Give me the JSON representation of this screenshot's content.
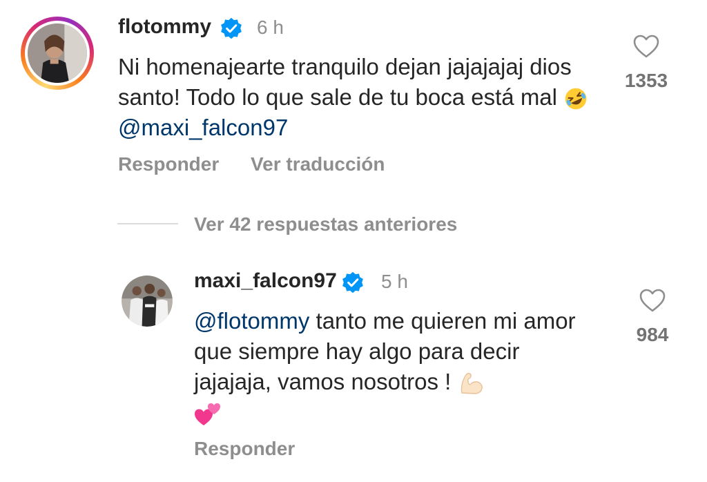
{
  "comment": {
    "username": "flotommy",
    "time": "6 h",
    "text_before": "Ni homenajearte tranquilo dejan jajajajaj dios santo! Todo lo que sale de tu boca está mal",
    "emoji": "rolling-on-floor-laughing",
    "mention": "@maxi_falcon97",
    "likes": "1353",
    "reply_label": "Responder",
    "translate_label": "Ver traducción"
  },
  "replies_toggle": {
    "label": "Ver 42 respuestas anteriores"
  },
  "reply": {
    "username": "maxi_falcon97",
    "time": "5 h",
    "mention": "@flotommy",
    "text": "tanto me quieren mi amor que siempre hay algo para decir jajajaja, vamos nosotros !",
    "emoji_1": "flexed-biceps-light-skin",
    "emoji_2": "two-hearts",
    "likes": "984",
    "reply_label": "Responder"
  },
  "colors": {
    "mention": "#00376b",
    "verified": "#0095f6",
    "secondary_text": "#8e8e8e",
    "primary_text": "#262626"
  }
}
